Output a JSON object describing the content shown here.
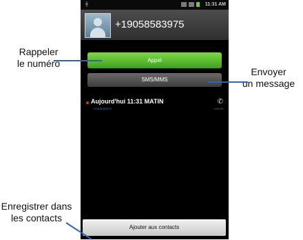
{
  "status_bar": {
    "time": "11:31 AM"
  },
  "contact": {
    "number": "+19058583975"
  },
  "buttons": {
    "call": "Appel",
    "sms": "SMS/MMS",
    "add_contact": "Ajouter aux contacts"
  },
  "log_entry": {
    "time": "Aujourd'hui 11:31 MATIN",
    "number": "+19058583975",
    "duration": "0:00:00"
  },
  "callouts": {
    "recall": [
      "Rappeler",
      "le numéro"
    ],
    "send_message": [
      "Envoyer",
      "un message"
    ],
    "save_contact": [
      "Enregistrer dans",
      "les contacts"
    ]
  },
  "colors": {
    "call_button": "#5cbf2a",
    "leader_line": "#2d63b8"
  }
}
